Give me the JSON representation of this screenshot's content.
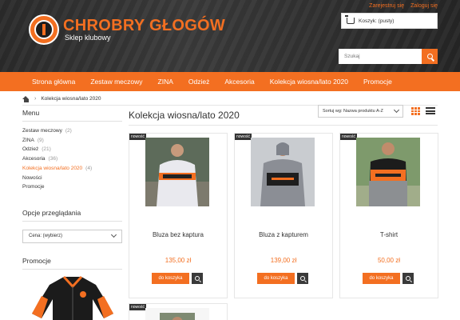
{
  "header": {
    "logo_title": "CHROBRY GŁOGÓW",
    "logo_subtitle": "Sklep klubowy",
    "top_links": [
      "Zarejestruj się",
      "Zaloguj się"
    ],
    "cart_label": "Koszyk: (pusty)",
    "search_placeholder": "Szukaj"
  },
  "nav": {
    "items": [
      "Strona główna",
      "Zestaw meczowy",
      "ZINA",
      "Odzież",
      "Akcesoria",
      "Kolekcja wiosna/lato 2020",
      "Promocje"
    ]
  },
  "breadcrumb": {
    "current": "Kolekcja wiosna/lato 2020"
  },
  "sidebar": {
    "menu_heading": "Menu",
    "menu_items": [
      {
        "label": "Zestaw meczowy",
        "count": "(2)"
      },
      {
        "label": "ZINA",
        "count": "(9)"
      },
      {
        "label": "Odzież",
        "count": "(21)"
      },
      {
        "label": "Akcesoria",
        "count": "(36)"
      },
      {
        "label": "Kolekcja wiosna/lato 2020",
        "count": "(4)",
        "active": true
      },
      {
        "label": "Nowości",
        "count": ""
      },
      {
        "label": "Promocje",
        "count": ""
      }
    ],
    "options_heading": "Opcje przeglądania",
    "price_select": "Cena: (wybierz)",
    "promo_heading": "Promocje"
  },
  "main": {
    "title": "Kolekcja wiosna/lato 2020",
    "sort_label": "Sortuj wg: Nazwa produktu A-Z",
    "products": [
      {
        "badge": "nowość",
        "name": "Bluza bez kaptura",
        "price": "135,00 zł",
        "button": "do koszyka",
        "shirt": "#e9e9ee",
        "accent": "#f36f21"
      },
      {
        "badge": "nowość",
        "name": "Bluza z kapturem",
        "price": "139,00 zł",
        "button": "do koszyka",
        "shirt": "#8b8e95",
        "accent": "#1e1e1e"
      },
      {
        "badge": "nowość",
        "name": "T-shirt",
        "price": "50,00 zł",
        "button": "do koszyka",
        "shirt": "#1c1c1c",
        "accent": "#f36f21"
      },
      {
        "badge": "nowość"
      }
    ]
  },
  "colors": {
    "accent": "#f36f21",
    "dark": "#2b2b2b"
  }
}
